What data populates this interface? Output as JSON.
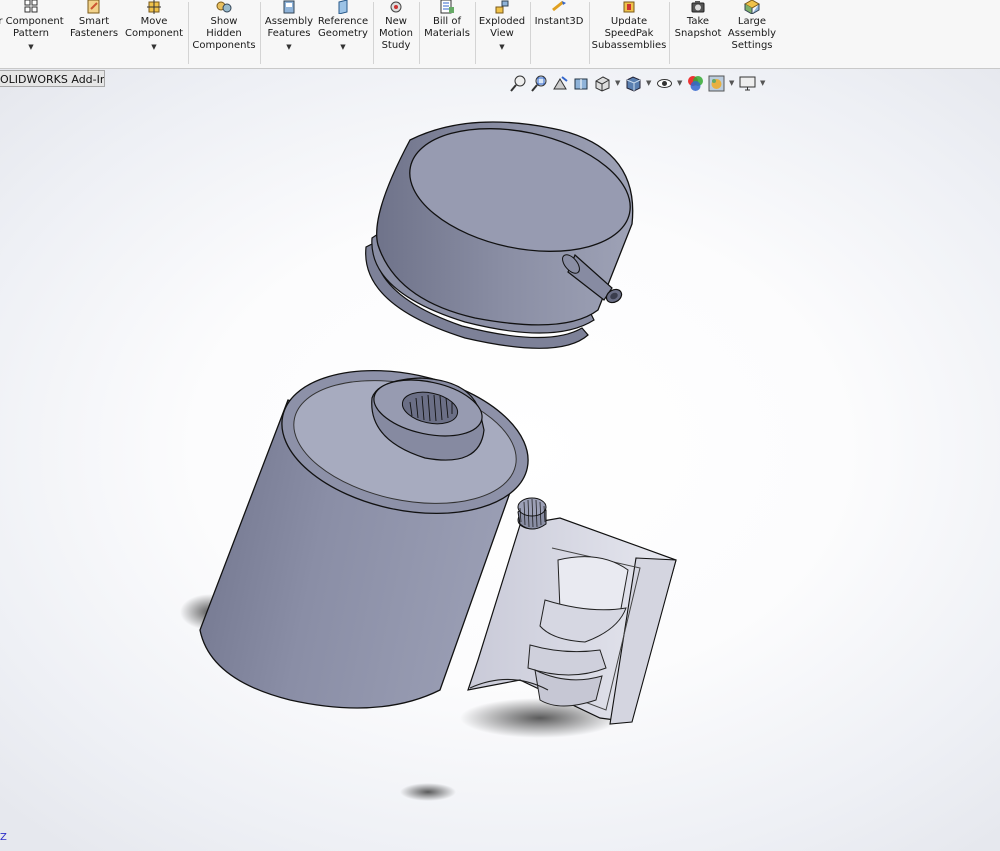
{
  "ribbon": {
    "buttons": [
      {
        "label": "r Component\nPattern",
        "icon": "component-pattern-icon",
        "dropdown": true
      },
      {
        "label": "Smart\nFasteners",
        "icon": "smart-fasteners-icon",
        "dropdown": false
      },
      {
        "label": "Move\nComponent",
        "icon": "move-component-icon",
        "dropdown": true
      },
      {
        "label": "Show\nHidden\nComponents",
        "icon": "show-hidden-components-icon",
        "dropdown": false
      },
      {
        "label": "Assembly\nFeatures",
        "icon": "assembly-features-icon",
        "dropdown": true
      },
      {
        "label": "Reference\nGeometry",
        "icon": "reference-geometry-icon",
        "dropdown": true
      },
      {
        "label": "New\nMotion\nStudy",
        "icon": "motion-study-icon",
        "dropdown": false
      },
      {
        "label": "Bill of\nMaterials",
        "icon": "bill-of-materials-icon",
        "dropdown": false
      },
      {
        "label": "Exploded\nView",
        "icon": "exploded-view-icon",
        "dropdown": true
      },
      {
        "label": "Instant3D",
        "icon": "instant3d-icon",
        "dropdown": false
      },
      {
        "label": "Update\nSpeedPak\nSubassemblies",
        "icon": "speedpak-icon",
        "dropdown": false
      },
      {
        "label": "Take\nSnapshot",
        "icon": "camera-icon",
        "dropdown": false
      },
      {
        "label": "Large\nAssembly\nSettings",
        "icon": "large-assembly-icon",
        "dropdown": false
      }
    ]
  },
  "tab": {
    "label": "OLIDWORKS Add-Ins"
  },
  "triad": {
    "label": "Z"
  },
  "colors": {
    "model_body": "#8a8ea4",
    "model_dark": "#5f637a",
    "ribbon_bg": "#f7f7f7"
  }
}
